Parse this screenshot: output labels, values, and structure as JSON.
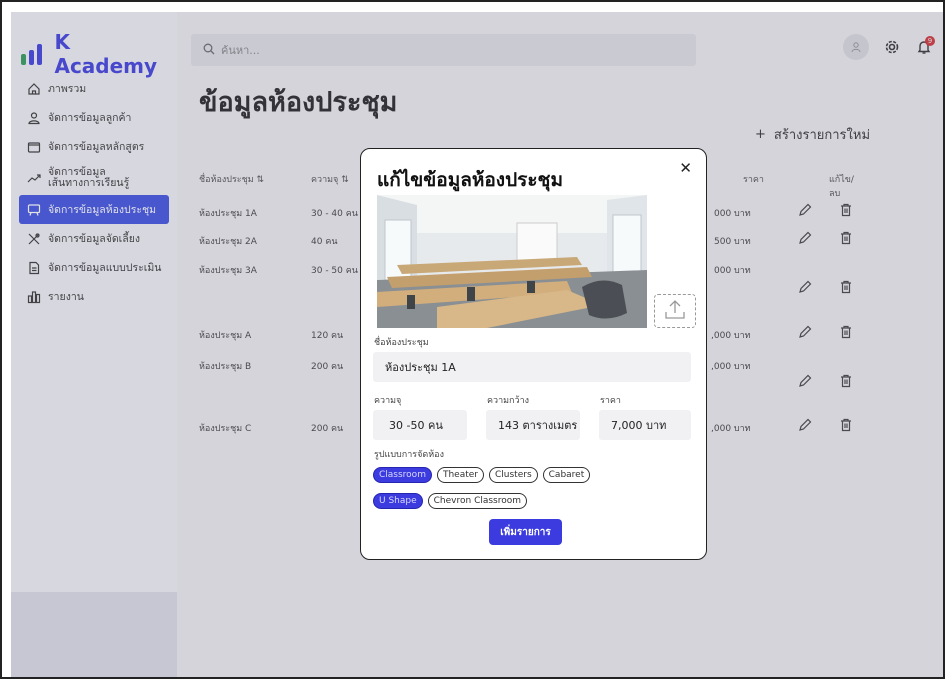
{
  "app": {
    "brand": "K Academy"
  },
  "sidebar": {
    "items": [
      {
        "label": "ภาพรวม",
        "icon": "home-icon"
      },
      {
        "label": "จัดการข้อมูลลูกค้า",
        "icon": "user-icon"
      },
      {
        "label": "จัดการข้อมูลหลักสูตร",
        "icon": "folder-icon"
      },
      {
        "label": "จัดการข้อมูล",
        "label2": "เส้นทางการเรียนรู้",
        "icon": "trend-icon"
      },
      {
        "label": "จัดการข้อมูลห้องประชุม",
        "icon": "chat-board-icon"
      },
      {
        "label": "จัดการข้อมูลจัดเลี้ยง",
        "icon": "utensils-icon"
      },
      {
        "label": "จัดการข้อมูลแบบประเมิน",
        "icon": "document-icon"
      },
      {
        "label": "รายงาน",
        "icon": "bar-chart-icon"
      }
    ],
    "active_index": 4
  },
  "header": {
    "search_placeholder": "ค้นหา...",
    "notification_count": "9"
  },
  "main": {
    "title": "ข้อมูลห้องประชุม",
    "create_label": "สร้างรายการใหม่",
    "columns": {
      "name": "ชื่อห้องประชุม",
      "capacity": "ความจุ",
      "price": "ราคา",
      "actions": "แก้ไข/ลบ"
    },
    "rows": [
      {
        "name": "ห้องประชุม 1A",
        "capacity": "30 - 40 คน",
        "price": "000 บาท"
      },
      {
        "name": "ห้องประชุม 2A",
        "capacity": "40 คน",
        "price": "500 บาท"
      },
      {
        "name": "ห้องประชุม 3A",
        "capacity": "30 - 50 คน",
        "price": "000 บาท"
      },
      {
        "name": "ห้องประชุม A",
        "capacity": "120 คน",
        "price": ",000 บาท"
      },
      {
        "name": "ห้องประชุม B",
        "capacity": "200 คน",
        "price": ",000 บาท"
      },
      {
        "name": "ห้องประชุม C",
        "capacity": "200 คน",
        "price": ",000 บาท"
      }
    ]
  },
  "modal": {
    "title": "แก้ไขข้อมูลห้องประชุม",
    "name_label": "ชื่อห้องประชุม",
    "name_value": "ห้องประชุม 1A",
    "capacity_label": "ความจุ",
    "capacity_value": "30 -50 คน",
    "size_label": "ความกว้าง",
    "size_value": "143 ตารางเมตร",
    "price_label": "ราคา",
    "price_value": "7,000 บาท",
    "layout_label": "รูปแบบการจัดห้อง",
    "layouts_row1": [
      {
        "label": "Classroom",
        "selected": true
      },
      {
        "label": "Theater",
        "selected": false
      },
      {
        "label": "Clusters",
        "selected": false
      },
      {
        "label": "Cabaret",
        "selected": false
      }
    ],
    "layouts_row2": [
      {
        "label": "U Shape",
        "selected": true
      },
      {
        "label": "Chevron Classroom",
        "selected": false
      }
    ],
    "submit_label": "เพิ่มรายการ"
  },
  "colors": {
    "accent": "#3b3bdf",
    "active_nav": "#3b4fe0",
    "badge": "#dd2222"
  }
}
